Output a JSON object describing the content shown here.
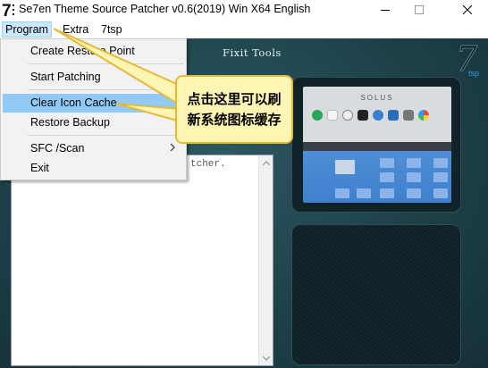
{
  "window": {
    "title": "Se7en Theme Source Patcher v0.6(2019) Win X64 English",
    "logo_text": "7"
  },
  "menubar": {
    "items": [
      "Program",
      "Extra",
      "7tsp"
    ]
  },
  "dropdown": {
    "items": [
      {
        "label": "Create Restore Point"
      },
      {
        "label": "Start Patching"
      },
      {
        "label": "Clear Icon Cache"
      },
      {
        "label": "Restore Backup"
      },
      {
        "label": "SFC /Scan"
      },
      {
        "label": "Exit"
      }
    ],
    "highlighted_item": "Clear Icon Cache"
  },
  "main": {
    "panel_title": "Fixit Tools",
    "brand_logo_text": "7",
    "brand_logo_sub": "tsp",
    "log_text": "tcher.",
    "preview": {
      "distro_name": "SOLUS"
    }
  },
  "callout": {
    "line1": "点击这里可以刷",
    "line2": "新系统图标缓存"
  },
  "colors": {
    "menu_highlight": "#91c9f7",
    "callout_bg": "#fff5b2",
    "callout_border": "#e2b93b",
    "main_bg": "#1d4149"
  }
}
